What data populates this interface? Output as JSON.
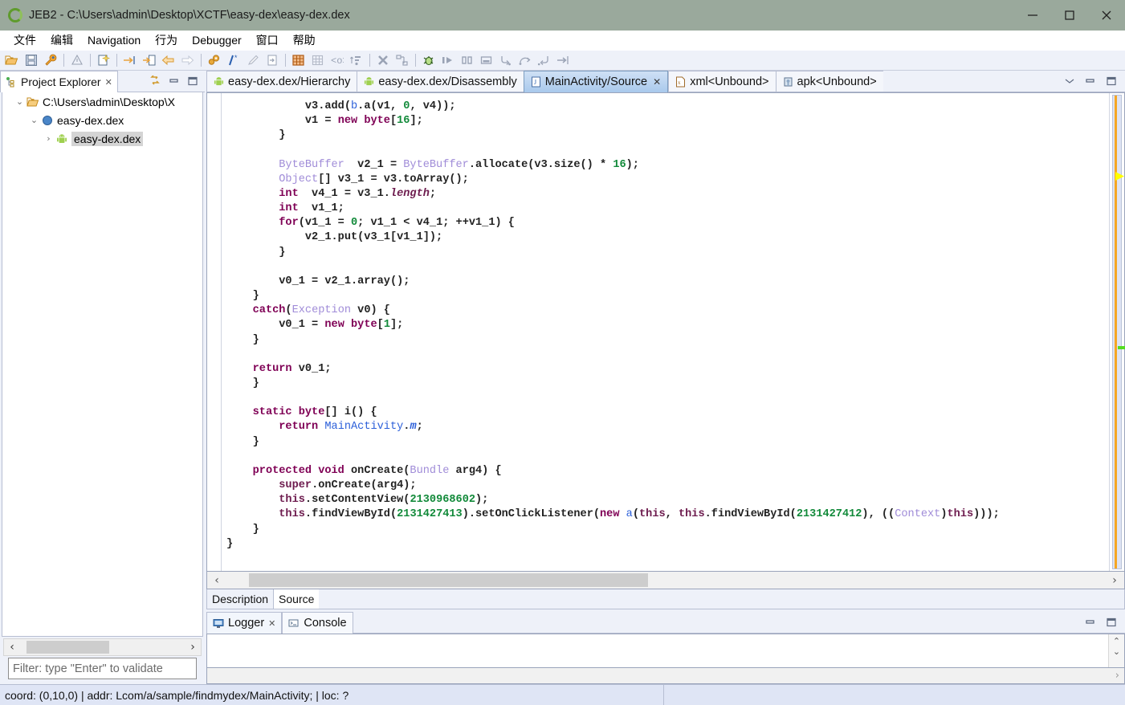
{
  "window": {
    "title": "JEB2 - C:\\Users\\admin\\Desktop\\XCTF\\easy-dex\\easy-dex.dex",
    "app_icon": "jeb-ring-icon",
    "minimize_label": "—",
    "maximize_label": "□",
    "close_label": "✕",
    "titlebar_color": "#9aa99c"
  },
  "menu": {
    "items": [
      {
        "label": "文件",
        "name": "menu-file"
      },
      {
        "label": "编辑",
        "name": "menu-edit"
      },
      {
        "label": "Navigation",
        "name": "menu-navigation"
      },
      {
        "label": "行为",
        "name": "menu-action"
      },
      {
        "label": "Debugger",
        "name": "menu-debugger"
      },
      {
        "label": "窗口",
        "name": "menu-window"
      },
      {
        "label": "帮助",
        "name": "menu-help"
      }
    ]
  },
  "toolbar": {
    "groups": [
      [
        "open-folder-icon",
        "save-icon",
        "wrench-icon"
      ],
      [
        "warning-icon"
      ],
      [
        "new-document-icon"
      ],
      [
        "jump-to-icon",
        "jump-to-document-icon",
        "back-arrow-icon",
        "forward-arrow-icon"
      ],
      [
        "gears-icon",
        "comment-icon",
        "pencil-icon",
        "export-icon"
      ],
      [
        "grid-active-icon",
        "grid-icon",
        "bracket-icon",
        "sort-icon"
      ],
      [
        "stop-icon",
        "disconnect-icon"
      ],
      [
        "debug-bug-icon",
        "resume-icon",
        "pause-icon",
        "terminate-icon",
        "step-into-icon",
        "step-over-icon",
        "step-return-icon",
        "run-to-line-icon"
      ]
    ]
  },
  "project_explorer": {
    "tab_label": "Project Explorer",
    "tab_icon": "project-explorer-icon",
    "close_label": "✕",
    "view_menu_icon": "link-with-editor-icon",
    "minimize_icon": "minimize-view-icon",
    "maximize_icon": "maximize-view-icon",
    "tree": [
      {
        "label": "C:\\Users\\admin\\Desktop\\X",
        "icon": "folder-icon",
        "expanded": true,
        "depth": 0,
        "selected": false
      },
      {
        "label": "easy-dex.dex",
        "icon": "blue-dot-icon",
        "expanded": true,
        "depth": 1,
        "selected": false
      },
      {
        "label": "easy-dex.dex",
        "icon": "android-icon",
        "expanded": false,
        "depth": 2,
        "selected": true
      }
    ],
    "hscroll_left": "‹",
    "hscroll_right": "›",
    "filter_placeholder": "Filter: type \"Enter\" to validate"
  },
  "editor": {
    "tabs": [
      {
        "label": "easy-dex.dex/Hierarchy",
        "icon": "android-icon",
        "active": false,
        "closable": false
      },
      {
        "label": "easy-dex.dex/Disassembly",
        "icon": "android-icon",
        "active": false,
        "closable": false
      },
      {
        "label": "MainActivity/Source",
        "icon": "java-icon",
        "active": true,
        "closable": true
      },
      {
        "label": "xml<Unbound>",
        "icon": "xml-icon",
        "active": false,
        "closable": false
      },
      {
        "label": "apk<Unbound>",
        "icon": "apk-icon",
        "active": false,
        "closable": false
      }
    ],
    "tab_close_label": "✕",
    "view_menu_icon": "chevron-down-icon",
    "minimize_icon": "minimize-view-icon",
    "maximize_icon": "maximize-view-icon",
    "code_lines": [
      "            v3.add(b.a(v1, 0, v4));",
      "            v1 = new byte[16];",
      "        }",
      "",
      "        ByteBuffer v2_1 = ByteBuffer.allocate(v3.size() * 16);",
      "        Object[] v3_1 = v3.toArray();",
      "        int v4_1 = v3_1.length;",
      "        int v1_1;",
      "        for(v1_1 = 0; v1_1 < v4_1; ++v1_1) {",
      "            v2_1.put(v3_1[v1_1]);",
      "        }",
      "",
      "        v0_1 = v2_1.array();",
      "    }",
      "    catch(Exception v0) {",
      "        v0_1 = new byte[1];",
      "    }",
      "",
      "    return v0_1;",
      "}",
      "",
      "static byte[] i() {",
      "    return MainActivity.m;",
      "}",
      "",
      "protected void onCreate(Bundle arg4) {",
      "    super.onCreate(arg4);",
      "    this.setContentView(2130968602);",
      "    this.findViewById(2131427413).setOnClickListener(new a(this, this.findViewById(2131427412), ((Context)this)));",
      "}",
      "}"
    ],
    "hscroll_left": "‹",
    "hscroll_right": "›",
    "bottom_tabs": [
      {
        "label": "Description",
        "active": false
      },
      {
        "label": "Source",
        "active": true
      }
    ],
    "annotation": {
      "type": "red-arrow",
      "color": "#f7352f"
    },
    "markers": {
      "yellow": "bookmark-marker",
      "green": "occurrence-marker",
      "scrollbar_color": "#f5a623"
    }
  },
  "logger": {
    "tabs": [
      {
        "label": "Logger",
        "icon": "logger-icon",
        "active": true,
        "closable": true
      },
      {
        "label": "Console",
        "icon": "console-icon",
        "active": false,
        "closable": false
      }
    ],
    "close_label": "✕",
    "minimize_icon": "minimize-view-icon",
    "maximize_icon": "maximize-view-icon",
    "content": "",
    "scroll_up": "⌃",
    "scroll_down": "⌄",
    "hscroll_right": "›"
  },
  "status_bar": {
    "text": "coord: (0,10,0) | addr: Lcom/a/sample/findmydex/MainActivity; | loc: ?",
    "right_text": ""
  }
}
